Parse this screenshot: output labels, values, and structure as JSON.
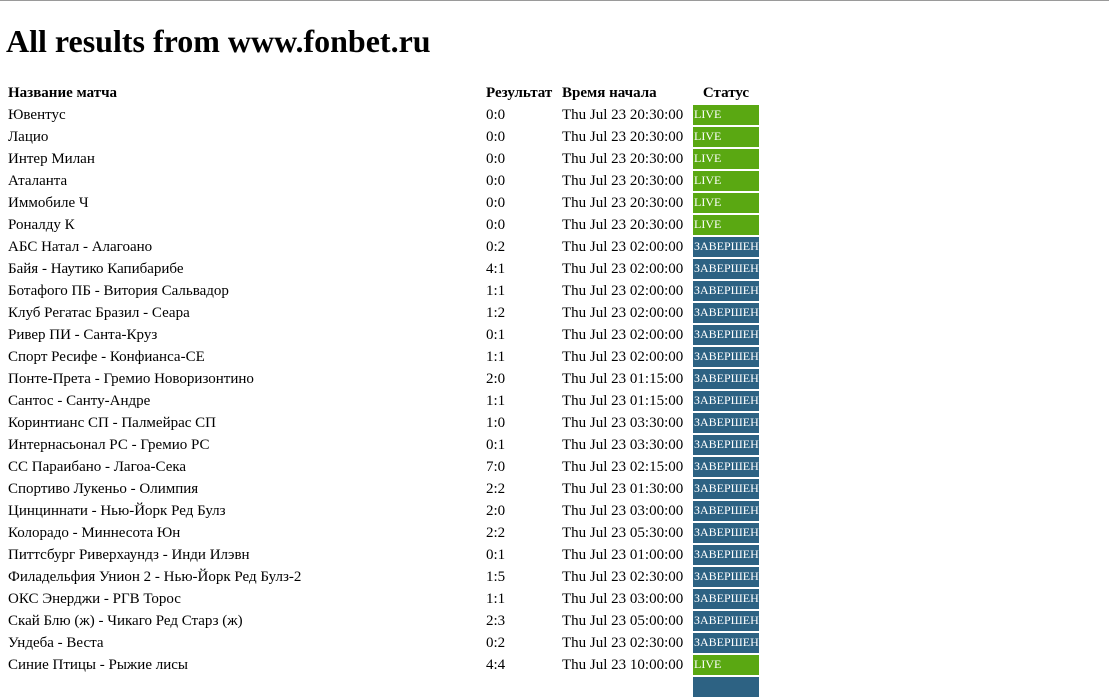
{
  "page": {
    "title": "All results from www.fonbet.ru"
  },
  "colors": {
    "live": "#5aa812",
    "done": "#2d6283"
  },
  "table": {
    "headers": {
      "name": "Название матча",
      "result": "Результат",
      "start": "Время начала",
      "status": "Статус"
    },
    "rows": [
      {
        "name": "Ювентус",
        "result": "0:0",
        "start": "Thu Jul 23 20:30:00",
        "status": "LIVE"
      },
      {
        "name": "Лацио",
        "result": "0:0",
        "start": "Thu Jul 23 20:30:00",
        "status": "LIVE"
      },
      {
        "name": "Интер Милан",
        "result": "0:0",
        "start": "Thu Jul 23 20:30:00",
        "status": "LIVE"
      },
      {
        "name": "Аталанта",
        "result": "0:0",
        "start": "Thu Jul 23 20:30:00",
        "status": "LIVE"
      },
      {
        "name": "Иммобиле Ч",
        "result": "0:0",
        "start": "Thu Jul 23 20:30:00",
        "status": "LIVE"
      },
      {
        "name": "Роналду К",
        "result": "0:0",
        "start": "Thu Jul 23 20:30:00",
        "status": "LIVE"
      },
      {
        "name": "АБС Натал - Алагоано",
        "result": "0:2",
        "start": "Thu Jul 23 02:00:00",
        "status": "ЗАВЕРШЕН"
      },
      {
        "name": "Байя - Наутико Капибарибе",
        "result": "4:1",
        "start": "Thu Jul 23 02:00:00",
        "status": "ЗАВЕРШЕН"
      },
      {
        "name": "Ботафого ПБ - Витория Сальвадор",
        "result": "1:1",
        "start": "Thu Jul 23 02:00:00",
        "status": "ЗАВЕРШЕН"
      },
      {
        "name": "Клуб Регатас Бразил - Сеара",
        "result": "1:2",
        "start": "Thu Jul 23 02:00:00",
        "status": "ЗАВЕРШЕН"
      },
      {
        "name": "Ривер ПИ - Санта-Круз",
        "result": "0:1",
        "start": "Thu Jul 23 02:00:00",
        "status": "ЗАВЕРШЕН"
      },
      {
        "name": "Спорт Ресифе - Конфианса-СЕ",
        "result": "1:1",
        "start": "Thu Jul 23 02:00:00",
        "status": "ЗАВЕРШЕН"
      },
      {
        "name": "Понте-Прета - Гремио Новоризонтино",
        "result": "2:0",
        "start": "Thu Jul 23 01:15:00",
        "status": "ЗАВЕРШЕН"
      },
      {
        "name": "Сантос - Санту-Андре",
        "result": "1:1",
        "start": "Thu Jul 23 01:15:00",
        "status": "ЗАВЕРШЕН"
      },
      {
        "name": "Коринтианс СП - Палмейрас СП",
        "result": "1:0",
        "start": "Thu Jul 23 03:30:00",
        "status": "ЗАВЕРШЕН"
      },
      {
        "name": "Интернасьонал РС - Гремио РС",
        "result": "0:1",
        "start": "Thu Jul 23 03:30:00",
        "status": "ЗАВЕРШЕН"
      },
      {
        "name": "СС Параибано - Лагоа-Сека",
        "result": "7:0",
        "start": "Thu Jul 23 02:15:00",
        "status": "ЗАВЕРШЕН"
      },
      {
        "name": "Спортиво Лукеньо - Олимпия",
        "result": "2:2",
        "start": "Thu Jul 23 01:30:00",
        "status": "ЗАВЕРШЕН"
      },
      {
        "name": "Цинциннати - Нью-Йорк Ред Булз",
        "result": "2:0",
        "start": "Thu Jul 23 03:00:00",
        "status": "ЗАВЕРШЕН"
      },
      {
        "name": "Колорадо - Миннесота Юн",
        "result": "2:2",
        "start": "Thu Jul 23 05:30:00",
        "status": "ЗАВЕРШЕН"
      },
      {
        "name": "Питтсбург Риверхаундз - Инди Илэвн",
        "result": "0:1",
        "start": "Thu Jul 23 01:00:00",
        "status": "ЗАВЕРШЕН"
      },
      {
        "name": "Филадельфия Унион 2 - Нью-Йорк Ред Булз-2",
        "result": "1:5",
        "start": "Thu Jul 23 02:30:00",
        "status": "ЗАВЕРШЕН"
      },
      {
        "name": "ОКС Энерджи - РГВ Торос",
        "result": "1:1",
        "start": "Thu Jul 23 03:00:00",
        "status": "ЗАВЕРШЕН"
      },
      {
        "name": "Скай Блю (ж) - Чикаго Ред Старз (ж)",
        "result": "2:3",
        "start": "Thu Jul 23 05:00:00",
        "status": "ЗАВЕРШЕН"
      },
      {
        "name": "Ундеба - Веста",
        "result": "0:2",
        "start": "Thu Jul 23 02:30:00",
        "status": "ЗАВЕРШЕН"
      },
      {
        "name": "Синие Птицы - Рыжие лисы",
        "result": "4:4",
        "start": "Thu Jul 23 10:00:00",
        "status": "LIVE"
      },
      {
        "name": "",
        "result": "",
        "start": "",
        "status": ""
      }
    ]
  }
}
